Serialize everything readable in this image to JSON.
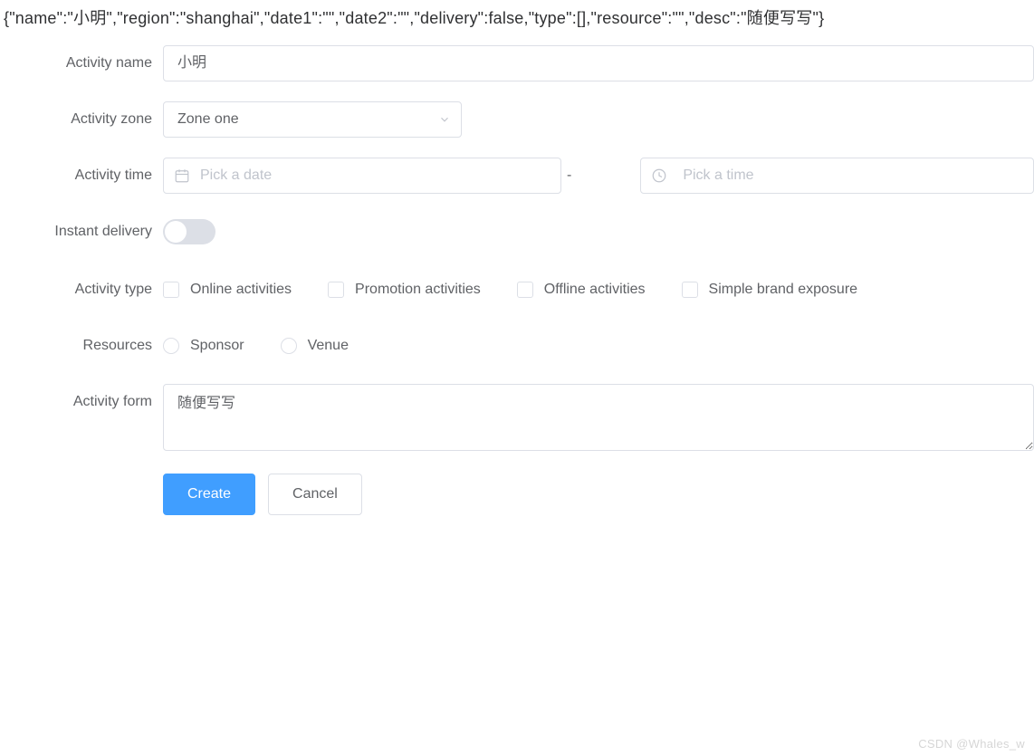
{
  "json_line": "{\"name\":\"小明\",\"region\":\"shanghai\",\"date1\":\"\",\"date2\":\"\",\"delivery\":false,\"type\":[],\"resource\":\"\",\"desc\":\"随便写写\"}",
  "labels": {
    "name": "Activity name",
    "zone": "Activity zone",
    "time": "Activity time",
    "delivery": "Instant delivery",
    "type": "Activity type",
    "resources": "Resources",
    "form": "Activity form"
  },
  "name_value": "小明",
  "zone_value": "Zone one",
  "date_placeholder": "Pick a date",
  "time_placeholder": "Pick a time",
  "dash": "-",
  "type_options": {
    "online": "Online activities",
    "promotion": "Promotion activities",
    "offline": "Offline activities",
    "simple": "Simple brand exposure"
  },
  "resource_options": {
    "sponsor": "Sponsor",
    "venue": "Venue"
  },
  "desc_value": "随便写写",
  "buttons": {
    "create": "Create",
    "cancel": "Cancel"
  },
  "watermark": "CSDN @Whales_w"
}
